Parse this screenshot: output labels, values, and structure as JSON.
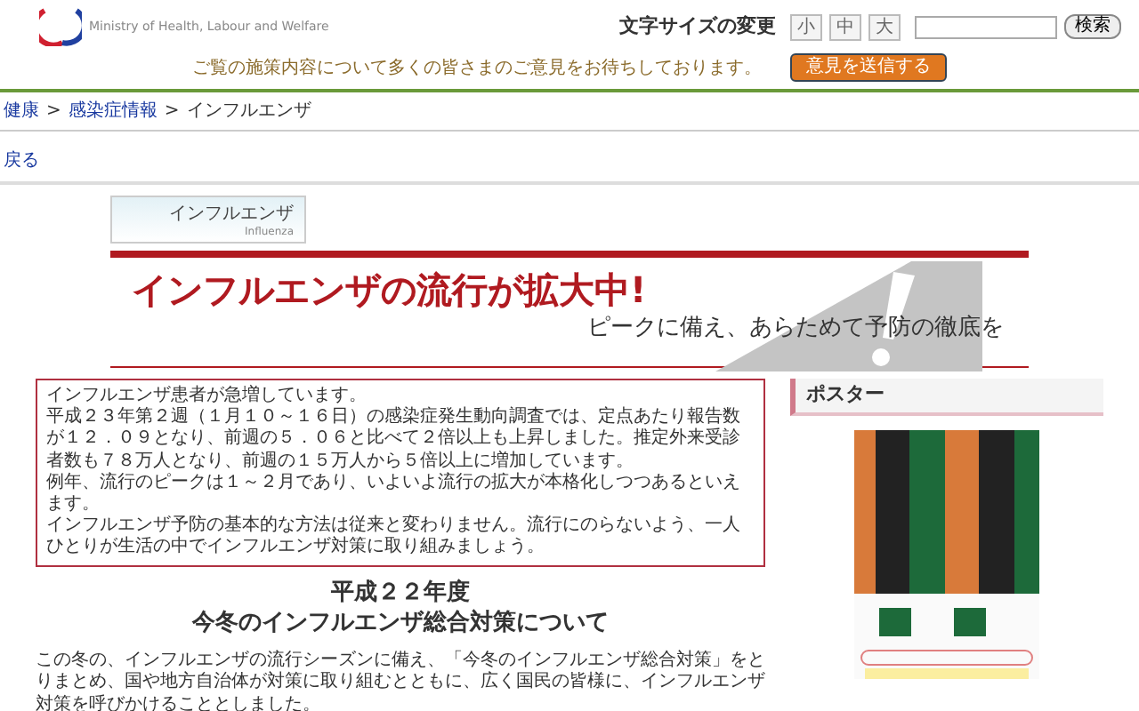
{
  "header": {
    "ministry_name": "Ministry of Health, Labour and Welfare",
    "font_size_label": "文字サイズの変更",
    "font_size_buttons": [
      "小",
      "中",
      "大"
    ],
    "search_button": "検索",
    "feedback_message": "ご覧の施策内容について多くの皆さまのご意見をお待ちしております。",
    "feedback_button": "意見を送信する"
  },
  "breadcrumb": [
    {
      "kind": "link",
      "label": "健康"
    },
    {
      "kind": "separator",
      "label": ">"
    },
    {
      "kind": "link",
      "label": "感染症情報"
    },
    {
      "kind": "separator",
      "label": ">"
    },
    {
      "kind": "current",
      "label": "インフルエンザ"
    }
  ],
  "back_link": "戻る",
  "section_tab": {
    "title": "インフルエンザ",
    "subtitle": "Influenza"
  },
  "banner": {
    "headline": "インフルエンザの流行が拡大中!",
    "subline": "ピークに備え、あらためて予防の徹底を"
  },
  "notice": [
    "インフルエンザ患者が急増しています。",
    "平成２３年第２週（１月１０～１６日）の感染症発生動向調査では、定点あたり報告数が１２．０９となり、前週の５．０６と比べて２倍以上も上昇しました。推定外来受診者数も７８万人となり、前週の１５万人から５倍以上に増加しています。",
    "例年、流行のピークは１～２月であり、いよいよ流行の拡大が本格化しつつあるといえます。",
    "インフルエンザ予防の基本的な方法は従来と変わりません。流行にのらないよう、一人ひとりが生活の中でインフルエンザ対策に取り組みましょう。"
  ],
  "heading": [
    "平成２２年度",
    "今冬のインフルエンザ総合対策について"
  ],
  "intro": "この冬の、インフルエンザの流行シーズンに備え、「今冬のインフルエンザ総合対策」をとりまとめ、国や地方自治体が対策に取り組むとともに、広く国民の皆様に、インフルエンザ対策を呼びかけることとしました。",
  "sidebar": {
    "title": "ポスター"
  }
}
